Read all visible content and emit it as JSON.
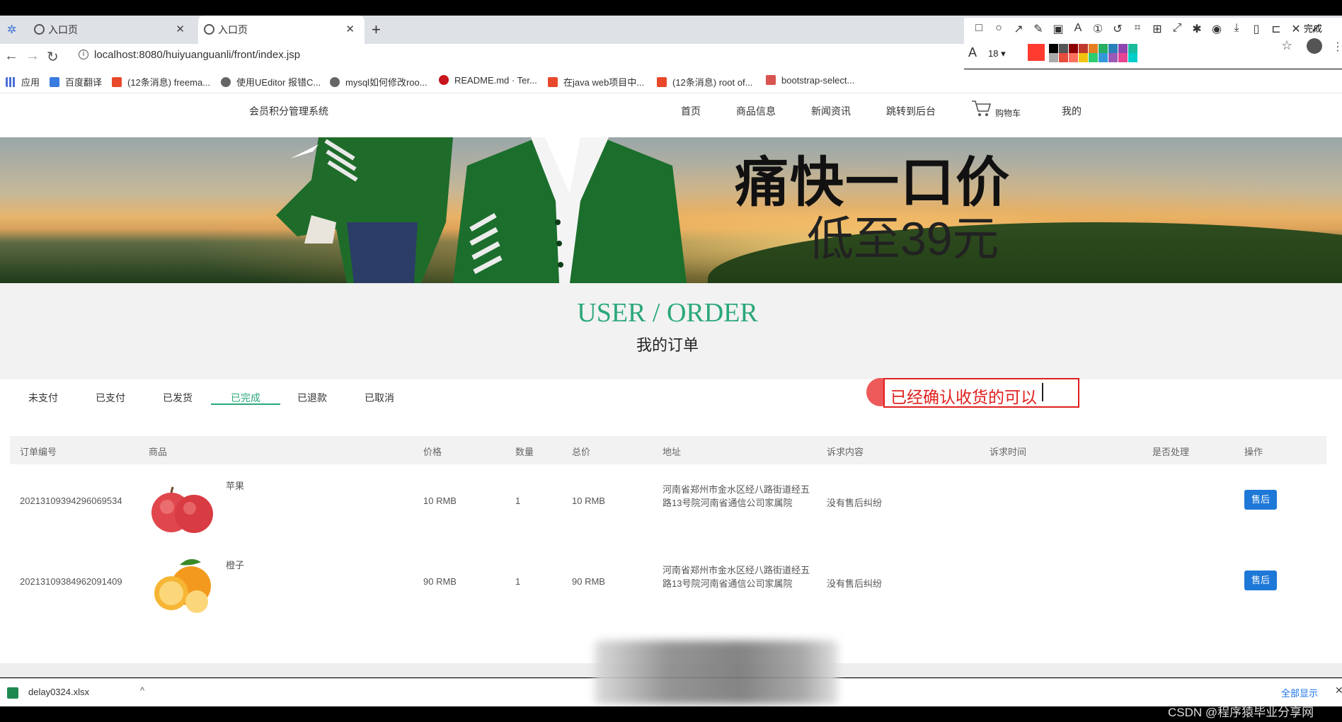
{
  "browser": {
    "tabs": [
      {
        "label": "入口页"
      },
      {
        "label": "入口页"
      }
    ],
    "new_tab": "+",
    "url": "localhost:8080/huiyuanguanli/front/index.jsp",
    "bookmarks": [
      {
        "label": "应用"
      },
      {
        "label": "百度翻译"
      },
      {
        "label": "(12条消息) freema..."
      },
      {
        "label": "使用UEditor 报错C..."
      },
      {
        "label": "mysql如何修改roo..."
      },
      {
        "label": "README.md · Ter..."
      },
      {
        "label": "在java web项目中..."
      },
      {
        "label": "(12条消息) root of..."
      },
      {
        "label": "bootstrap-select..."
      }
    ]
  },
  "annotation_toolbar": {
    "done_label": "完成",
    "font_size": "18",
    "colors": [
      "#ff3b30",
      "#000000",
      "#555555",
      "#8b0000",
      "#c0392b",
      "#e67e22",
      "#27ae60",
      "#2980b9",
      "#8e44ad",
      "#1abc9c",
      "#ffffff",
      "#aaaaaa",
      "#e74c3c",
      "#ff6f61",
      "#f1c40f",
      "#2ecc71",
      "#3498db",
      "#9b59b6",
      "#e84393",
      "#00cec9"
    ]
  },
  "header": {
    "brand": "会员积分管理系统",
    "nav": [
      {
        "label": "首页"
      },
      {
        "label": "商品信息"
      },
      {
        "label": "新闻资讯"
      },
      {
        "label": "跳转到后台"
      },
      {
        "label": "购物车"
      },
      {
        "label": "我的"
      }
    ]
  },
  "banner": {
    "title": "痛快一口价",
    "subtitle": "低至39元"
  },
  "section": {
    "title_en": "USER / ORDER",
    "title_cn": "我的订单"
  },
  "order_tabs": [
    {
      "label": "未支付",
      "active": false
    },
    {
      "label": "已支付",
      "active": false
    },
    {
      "label": "已发货",
      "active": false
    },
    {
      "label": "已完成",
      "active": true
    },
    {
      "label": "已退款",
      "active": false
    },
    {
      "label": "已取消",
      "active": false
    }
  ],
  "annotation": {
    "text": "已经确认收货的可以"
  },
  "table": {
    "headers": [
      "订单编号",
      "商品",
      "价格",
      "数量",
      "总价",
      "地址",
      "诉求内容",
      "诉求时间",
      "是否处理",
      "操作"
    ],
    "rows": [
      {
        "order_no": "20213109394296069534",
        "product": "苹果",
        "price": "10 RMB",
        "qty": "1",
        "total": "10 RMB",
        "address": "河南省郑州市金水区经八路街道经五路13号院河南省通信公司家属院",
        "appeal": "没有售后纠纷",
        "appeal_time": "",
        "handled": "",
        "action": "售后"
      },
      {
        "order_no": "20213109384962091409",
        "product": "橙子",
        "price": "90 RMB",
        "qty": "1",
        "total": "90 RMB",
        "address": "河南省郑州市金水区经八路街道经五路13号院河南省通信公司家属院",
        "appeal": "没有售后纠纷",
        "appeal_time": "",
        "handled": "",
        "action": "售后"
      }
    ]
  },
  "download_bar": {
    "file": "delay0324.xlsx",
    "show_all": "全部显示"
  },
  "watermark": "CSDN @程序猿毕业分享网"
}
